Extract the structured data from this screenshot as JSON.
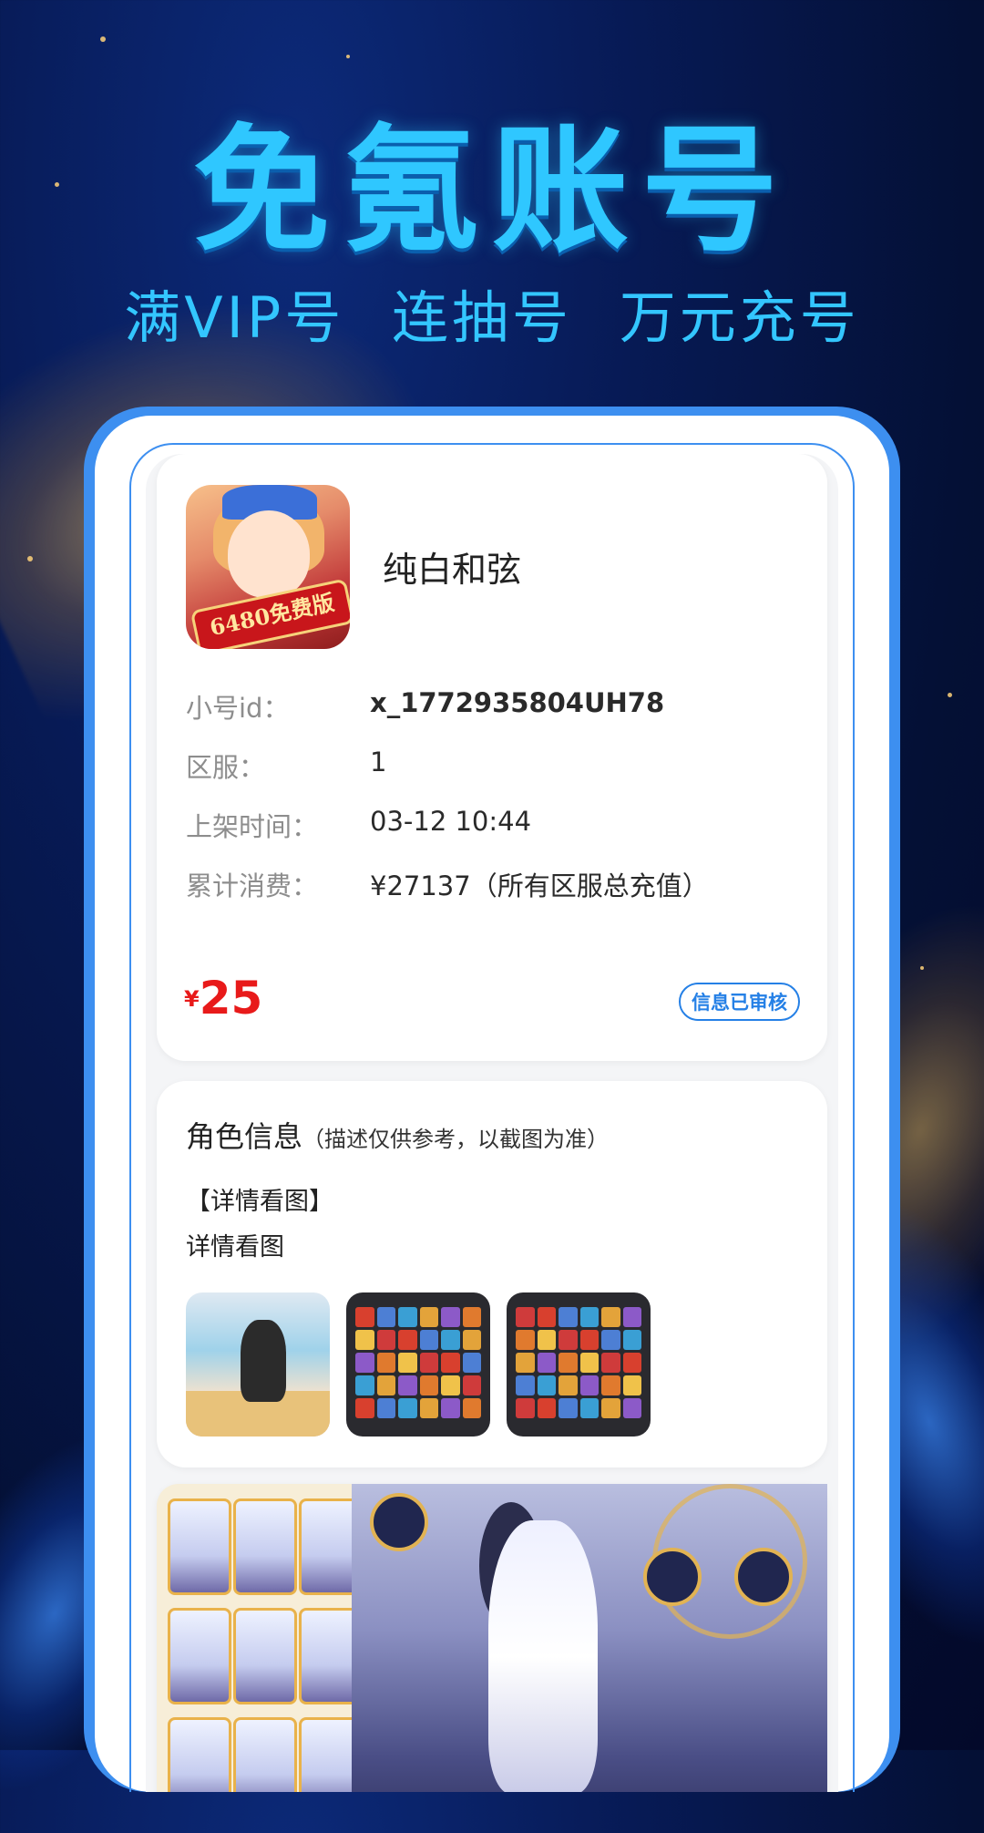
{
  "hero": {
    "title": "免氪账号",
    "subtitle": "满VIP号  连抽号  万元充号"
  },
  "listing": {
    "game_icon": "game-cover-icon",
    "game_icon_banner": "6480免费版",
    "game_name": "纯白和弦",
    "fields": [
      {
        "label": "小号id：",
        "value": "x_1772935804UH78"
      },
      {
        "label": "区服：",
        "value": "1"
      },
      {
        "label": "上架时间：",
        "value": "03-12 10:44"
      },
      {
        "label": "累计消费：",
        "value": "¥27137（所有区服总充值）"
      }
    ],
    "price_currency": "¥",
    "price_amount": "25",
    "verified_badge": "信息已审核"
  },
  "role_info": {
    "title": "角色信息",
    "note": "（描述仅供参考，以截图为准）",
    "detail_heading": "【详情看图】",
    "detail_text": "详情看图",
    "screenshots": [
      "screenshot-thumbnail",
      "screenshot-thumbnail",
      "screenshot-thumbnail"
    ]
  },
  "colors": {
    "accent_blue": "#2fc7ff",
    "frame_blue": "#3d8ff0",
    "price_red": "#e81a1a",
    "badge_blue": "#2580e6"
  }
}
